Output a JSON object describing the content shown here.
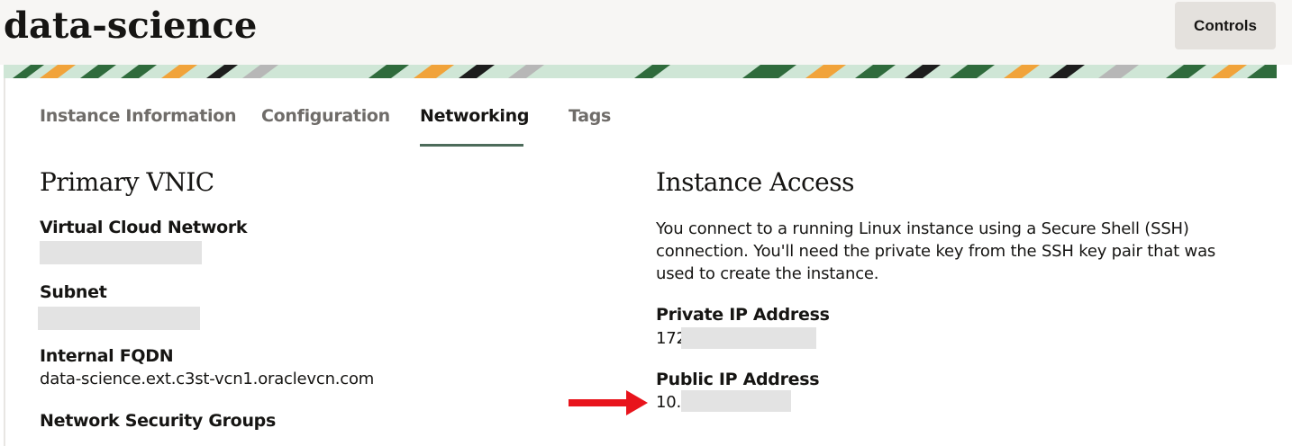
{
  "header": {
    "title": "data-science",
    "controls_label": "Controls"
  },
  "tabs": [
    {
      "label": "Instance Information",
      "active": false
    },
    {
      "label": "Configuration",
      "active": false
    },
    {
      "label": "Networking",
      "active": true
    },
    {
      "label": "Tags",
      "active": false
    }
  ],
  "primary_vnic": {
    "heading": "Primary VNIC",
    "vcn_label": "Virtual Cloud Network",
    "subnet_label": "Subnet",
    "fqdn_label": "Internal FQDN",
    "fqdn_value": "data-science.ext.c3st-vcn1.oraclevcn.com",
    "nsg_label": "Network Security Groups"
  },
  "instance_access": {
    "heading": "Instance Access",
    "description": "You connect to a running Linux instance using a Secure Shell (SSH) connection. You'll need the private key from the SSH key pair that was used to create the instance.",
    "private_ip_label": "Private IP Address",
    "private_ip_visible": "172",
    "public_ip_label": "Public IP Address",
    "public_ip_visible": "10.:"
  },
  "colors": {
    "accent": "#4d6b5a",
    "arrow": "#e8141c",
    "redaction": "#e3e3e3"
  },
  "icons": {
    "annotation": "red-arrow-icon"
  }
}
